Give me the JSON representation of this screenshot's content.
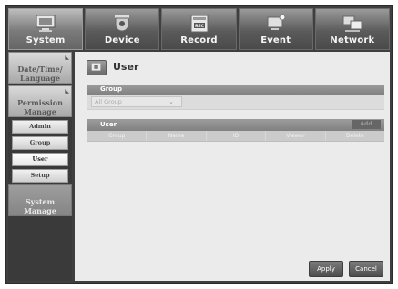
{
  "nav": {
    "tabs": [
      {
        "label": "System",
        "icon": "monitor-icon",
        "active": true
      },
      {
        "label": "Device",
        "icon": "camera-icon",
        "active": false
      },
      {
        "label": "Record",
        "icon": "record-icon",
        "active": false
      },
      {
        "label": "Event",
        "icon": "event-icon",
        "active": false
      },
      {
        "label": "Network",
        "icon": "network-icon",
        "active": false
      }
    ]
  },
  "sidebar": {
    "categories": [
      {
        "label": "Date/Time/\nLanguage"
      },
      {
        "label": "Permission\nManage"
      },
      {
        "label": "System\nManage"
      }
    ],
    "items": [
      {
        "label": "Admin",
        "active": false
      },
      {
        "label": "Group",
        "active": false
      },
      {
        "label": "User",
        "active": true
      },
      {
        "label": "Setup",
        "active": false
      }
    ]
  },
  "main": {
    "title": "User",
    "group_section": {
      "heading": "Group",
      "select_value": "All Group"
    },
    "user_section": {
      "heading": "User",
      "add_label": "Add",
      "columns": [
        "Group",
        "Name",
        "ID",
        "Viewer",
        "Delete"
      ]
    },
    "buttons": {
      "apply": "Apply",
      "cancel": "Cancel"
    }
  },
  "colors": {
    "frame_bg": "#3f3f3f",
    "panel_bg": "#ebebeb",
    "header_bar": "#8f8f8f",
    "button": "#5c5c5c"
  }
}
